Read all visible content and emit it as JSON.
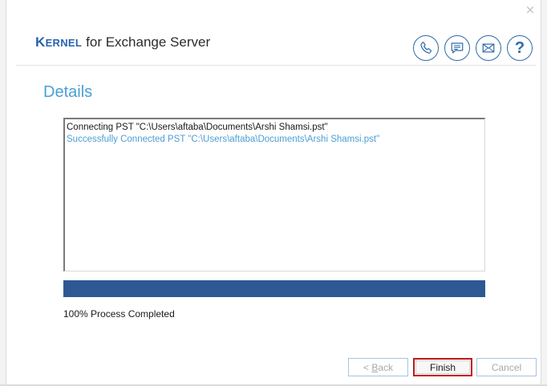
{
  "window": {
    "close_glyph": "×"
  },
  "header": {
    "logo_k": "K",
    "logo_ernel": "ERNEL",
    "logo_rest": "for Exchange Server",
    "icons": [
      "phone-icon",
      "chat-icon",
      "mail-icon",
      "help-icon"
    ],
    "help_glyph": "?"
  },
  "main": {
    "title": "Details",
    "log": [
      {
        "text": "Connecting PST \"C:\\Users\\aftaba\\Documents\\Arshi Shamsi.pst\"",
        "kind": "normal"
      },
      {
        "text": "Successfully Connected PST \"C:\\Users\\aftaba\\Documents\\Arshi Shamsi.pst\"",
        "kind": "success"
      }
    ],
    "progress_percent": 100,
    "progress_text": "100% Process Completed"
  },
  "footer": {
    "back_prefix": "< ",
    "back_underlined": "B",
    "back_rest": "ack",
    "finish_label": "Finish",
    "cancel_label": "Cancel"
  },
  "colors": {
    "brand": "#2a63ad",
    "accent": "#4a9fd6",
    "progress": "#2d5894",
    "focus_border": "#c4171d"
  }
}
